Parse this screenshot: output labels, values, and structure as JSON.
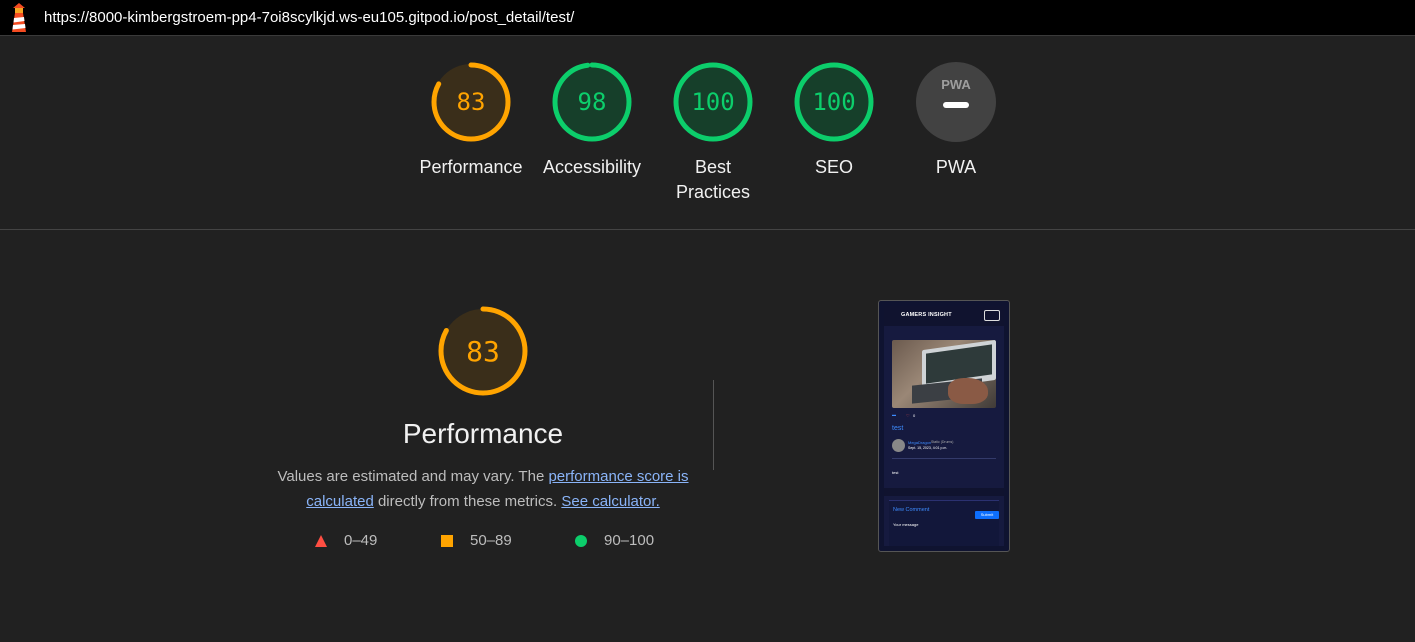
{
  "browser": {
    "url": "https://8000-kimbergstroem-pp4-7oi8scylkjd.ws-eu105.gitpod.io/post_detail/test/"
  },
  "colors": {
    "average": "#ffa400",
    "pass": "#0cce6b",
    "fail": "#ff4e42",
    "pwa": "#424242"
  },
  "gauges": [
    {
      "label": "Performance",
      "score": "83",
      "fraction": 0.83,
      "rating": "average"
    },
    {
      "label": "Accessibility",
      "score": "98",
      "fraction": 0.98,
      "rating": "pass"
    },
    {
      "label": "Best Practices",
      "score": "100",
      "fraction": 1.0,
      "rating": "pass"
    },
    {
      "label": "SEO",
      "score": "100",
      "fraction": 1.0,
      "rating": "pass"
    },
    {
      "label": "PWA",
      "icon": "pwa-badge-icon",
      "badge_text": "PWA"
    }
  ],
  "performance": {
    "score": "83",
    "fraction": 0.83,
    "title": "Performance",
    "desc_prefix": "Values are estimated and may vary. The ",
    "link_score": "performance score is calculated",
    "desc_middle": " directly from these metrics. ",
    "link_calc": "See calculator."
  },
  "legend": [
    {
      "range": "0–49",
      "icon": "triangle-icon"
    },
    {
      "range": "50–89",
      "icon": "square-icon"
    },
    {
      "range": "90–100",
      "icon": "circle-icon"
    }
  ],
  "screenshot": {
    "brand": "GAMERS INSIGHT",
    "post_title": "test",
    "author": "MegaDragon",
    "author_note": "Static (Drums)",
    "date": "Sept. 15, 2023, 4:01 p.m.",
    "likes": "0",
    "body": "test",
    "form_title": "New Comment",
    "form_label": "Your message",
    "submit": "Submit"
  }
}
